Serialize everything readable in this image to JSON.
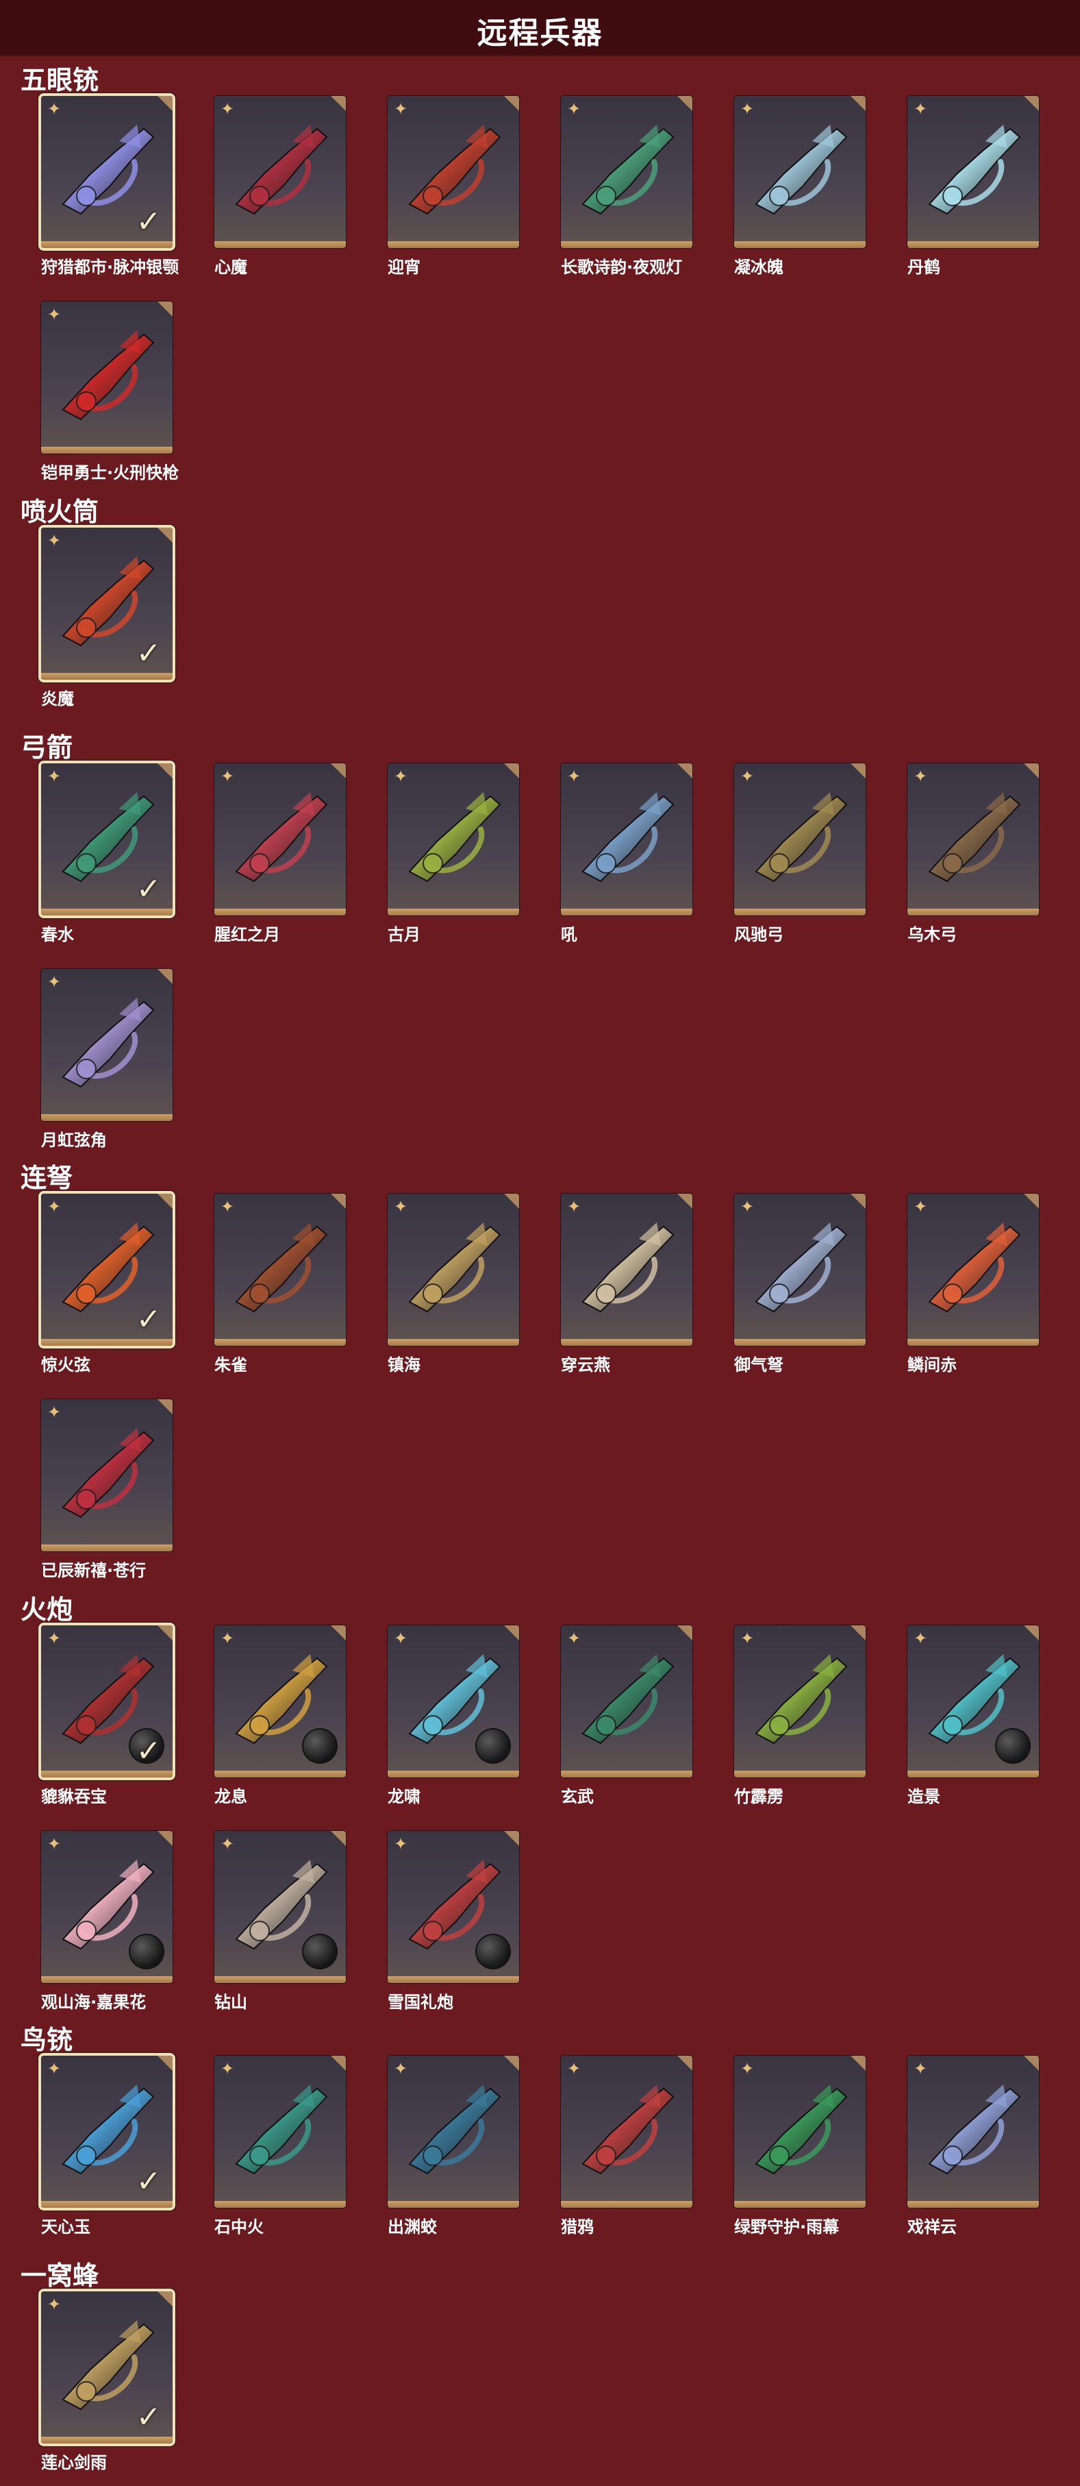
{
  "page": {
    "title": "远程兵器"
  },
  "colors": {
    "background": "#6b1a1f",
    "topbar": "#3f0c10",
    "card_border_selected": "#efe2b6",
    "accent_gold": "#caa068"
  },
  "icons": {
    "rarity": "sparkle-icon",
    "equipped": "checkmark-icon",
    "ammo": "cannonball-icon"
  },
  "categories": [
    {
      "name": "五眼铳",
      "items": [
        {
          "label": "狩猎都市·脉冲银颚",
          "selected": true,
          "orb": false,
          "color": "#8f8fe6"
        },
        {
          "label": "心魔",
          "selected": false,
          "orb": false,
          "color": "#b03040"
        },
        {
          "label": "迎宵",
          "selected": false,
          "orb": false,
          "color": "#c0402e"
        },
        {
          "label": "长歌诗韵·夜观灯",
          "selected": false,
          "orb": false,
          "color": "#4aa07a"
        },
        {
          "label": "凝冰魄",
          "selected": false,
          "orb": false,
          "color": "#9cc6d8"
        },
        {
          "label": "丹鹤",
          "selected": false,
          "orb": false,
          "color": "#a8dce8"
        },
        {
          "label": "铠甲勇士·火刑快枪",
          "selected": false,
          "orb": false,
          "color": "#cf2a2a"
        }
      ]
    },
    {
      "name": "喷火筒",
      "items": [
        {
          "label": "炎魔",
          "selected": true,
          "orb": false,
          "color": "#d0472a"
        }
      ]
    },
    {
      "name": "弓箭",
      "items": [
        {
          "label": "春水",
          "selected": true,
          "orb": false,
          "color": "#3f9a7a"
        },
        {
          "label": "腥红之月",
          "selected": false,
          "orb": false,
          "color": "#c04050"
        },
        {
          "label": "古月",
          "selected": false,
          "orb": false,
          "color": "#9ab040"
        },
        {
          "label": "吼",
          "selected": false,
          "orb": false,
          "color": "#7aa0c8"
        },
        {
          "label": "风驰弓",
          "selected": false,
          "orb": false,
          "color": "#a08a50"
        },
        {
          "label": "乌木弓",
          "selected": false,
          "orb": false,
          "color": "#8a6a48"
        },
        {
          "label": "月虹弦角",
          "selected": false,
          "orb": false,
          "color": "#a090d0"
        }
      ]
    },
    {
      "name": "连弩",
      "items": [
        {
          "label": "惊火弦",
          "selected": true,
          "orb": false,
          "color": "#e0602a"
        },
        {
          "label": "朱雀",
          "selected": false,
          "orb": false,
          "color": "#a05030"
        },
        {
          "label": "镇海",
          "selected": false,
          "orb": false,
          "color": "#c0a060"
        },
        {
          "label": "穿云燕",
          "selected": false,
          "orb": false,
          "color": "#d0c0a0"
        },
        {
          "label": "御气弩",
          "selected": false,
          "orb": false,
          "color": "#a0b0d0"
        },
        {
          "label": "鳞间赤",
          "selected": false,
          "orb": false,
          "color": "#e0603a"
        },
        {
          "label": "已辰新禧·苍行",
          "selected": false,
          "orb": false,
          "color": "#c03040"
        }
      ]
    },
    {
      "name": "火炮",
      "items": [
        {
          "label": "貔貅吞宝",
          "selected": true,
          "orb": true,
          "color": "#b03030"
        },
        {
          "label": "龙息",
          "selected": false,
          "orb": true,
          "color": "#d0a040"
        },
        {
          "label": "龙啸",
          "selected": false,
          "orb": true,
          "color": "#60c0d8"
        },
        {
          "label": "玄武",
          "selected": false,
          "orb": false,
          "color": "#3a8a6a"
        },
        {
          "label": "竹霹雳",
          "selected": false,
          "orb": false,
          "color": "#8ab040"
        },
        {
          "label": "造景",
          "selected": false,
          "orb": true,
          "color": "#50c0c8"
        },
        {
          "label": "观山海·嘉果花",
          "selected": false,
          "orb": true,
          "color": "#f0b0c0"
        },
        {
          "label": "钻山",
          "selected": false,
          "orb": true,
          "color": "#c0b0a0"
        },
        {
          "label": "雪国礼炮",
          "selected": false,
          "orb": true,
          "color": "#c04040"
        }
      ]
    },
    {
      "name": "鸟铳",
      "items": [
        {
          "label": "天心玉",
          "selected": true,
          "orb": false,
          "color": "#4aa0d8"
        },
        {
          "label": "石中火",
          "selected": false,
          "orb": false,
          "color": "#3a9a8a"
        },
        {
          "label": "出渊蛟",
          "selected": false,
          "orb": false,
          "color": "#3a7a9a"
        },
        {
          "label": "猎鸦",
          "selected": false,
          "orb": false,
          "color": "#c04040"
        },
        {
          "label": "绿野守护·雨幕",
          "selected": false,
          "orb": false,
          "color": "#3a9a5a"
        },
        {
          "label": "戏祥云",
          "selected": false,
          "orb": false,
          "color": "#90a0d8"
        }
      ]
    },
    {
      "name": "一窝蜂",
      "items": [
        {
          "label": "莲心剑雨",
          "selected": true,
          "orb": false,
          "color": "#c0a060"
        }
      ]
    }
  ]
}
